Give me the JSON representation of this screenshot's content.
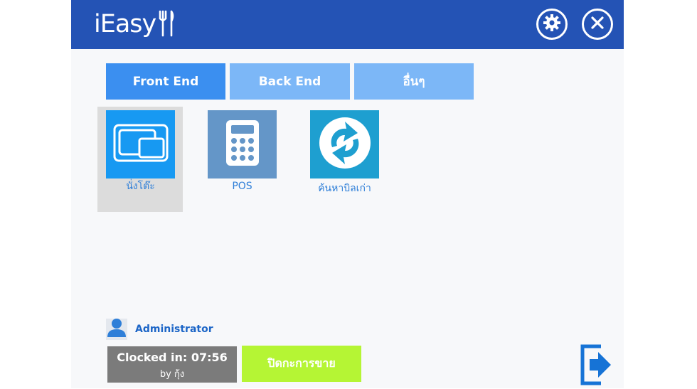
{
  "app": {
    "logo_text": "iEasy"
  },
  "header": {
    "settings_icon": "gear-icon",
    "close_icon": "close-icon"
  },
  "tabs": [
    {
      "label": "Front End"
    },
    {
      "label": "Back End"
    },
    {
      "label": "อื่นๆ"
    }
  ],
  "tiles": [
    {
      "label": "นั่งโต๊ะ",
      "icon": "tables-icon"
    },
    {
      "label": "POS",
      "icon": "calculator-icon"
    },
    {
      "label": "ค้นหาบิลเก่า",
      "icon": "refresh-bill-icon"
    }
  ],
  "user": {
    "name": "Administrator"
  },
  "clock": {
    "line1": "Clocked in: 07:56",
    "line2": "by กุ้ง"
  },
  "actions": {
    "close_sale": "ปิดกะการขาย",
    "exit_icon": "exit-icon"
  },
  "colors": {
    "header": "#2453b5",
    "tab_active": "#3b8ff0",
    "tab_inactive": "#7cb7f7",
    "tile_table": "#1799f2",
    "tile_pos": "#6496c8",
    "tile_bill": "#1e9fd0",
    "clock_bg": "#7b7b7b",
    "close_sale_bg": "#b5f534"
  }
}
